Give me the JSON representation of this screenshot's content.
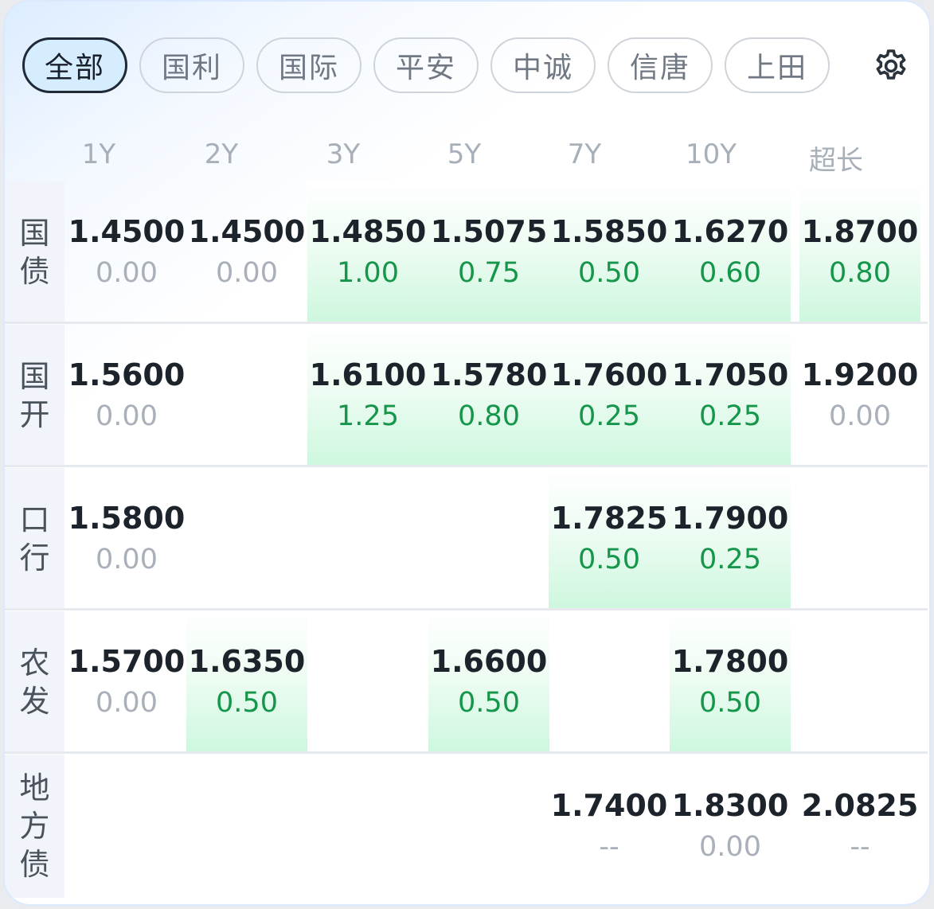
{
  "tabs": [
    {
      "label": "全部",
      "active": true
    },
    {
      "label": "国利",
      "active": false
    },
    {
      "label": "国际",
      "active": false
    },
    {
      "label": "平安",
      "active": false
    },
    {
      "label": "中诚",
      "active": false
    },
    {
      "label": "信唐",
      "active": false
    },
    {
      "label": "上田",
      "active": false
    }
  ],
  "settings_icon": "gear-icon",
  "columns": [
    "1Y",
    "2Y",
    "3Y",
    "5Y",
    "7Y",
    "10Y",
    "超长"
  ],
  "colors": {
    "up": "#16964a",
    "zero": "#a9b0b9",
    "up_bg": "#cdf7de"
  },
  "rows": [
    {
      "label": [
        "国",
        "债"
      ],
      "cells": [
        {
          "price": "1.4500",
          "change": "0.00",
          "state": "zero"
        },
        {
          "price": "1.4500",
          "change": "0.00",
          "state": "zero"
        },
        {
          "price": "1.4850",
          "change": "1.00",
          "state": "up"
        },
        {
          "price": "1.5075",
          "change": "0.75",
          "state": "up"
        },
        {
          "price": "1.5850",
          "change": "0.50",
          "state": "up"
        },
        {
          "price": "1.6270",
          "change": "0.60",
          "state": "up"
        },
        {
          "price": "1.8700",
          "change": "0.80",
          "state": "up"
        }
      ]
    },
    {
      "label": [
        "国",
        "开"
      ],
      "cells": [
        {
          "price": "1.5600",
          "change": "0.00",
          "state": "zero"
        },
        null,
        {
          "price": "1.6100",
          "change": "1.25",
          "state": "up"
        },
        {
          "price": "1.5780",
          "change": "0.80",
          "state": "up"
        },
        {
          "price": "1.7600",
          "change": "0.25",
          "state": "up"
        },
        {
          "price": "1.7050",
          "change": "0.25",
          "state": "up"
        },
        {
          "price": "1.9200",
          "change": "0.00",
          "state": "zero"
        }
      ]
    },
    {
      "label": [
        "口",
        "行"
      ],
      "cells": [
        {
          "price": "1.5800",
          "change": "0.00",
          "state": "zero"
        },
        null,
        null,
        null,
        {
          "price": "1.7825",
          "change": "0.50",
          "state": "up"
        },
        {
          "price": "1.7900",
          "change": "0.25",
          "state": "up"
        },
        null
      ]
    },
    {
      "label": [
        "农",
        "发"
      ],
      "cells": [
        {
          "price": "1.5700",
          "change": "0.00",
          "state": "zero"
        },
        {
          "price": "1.6350",
          "change": "0.50",
          "state": "up"
        },
        null,
        {
          "price": "1.6600",
          "change": "0.50",
          "state": "up"
        },
        null,
        {
          "price": "1.7800",
          "change": "0.50",
          "state": "up"
        },
        null
      ]
    },
    {
      "label": [
        "地",
        "方",
        "债"
      ],
      "cells": [
        null,
        null,
        null,
        null,
        {
          "price": "1.7400",
          "change": "--",
          "state": "zero"
        },
        {
          "price": "1.8300",
          "change": "0.00",
          "state": "zero"
        },
        {
          "price": "2.0825",
          "change": "--",
          "state": "zero"
        }
      ]
    }
  ]
}
